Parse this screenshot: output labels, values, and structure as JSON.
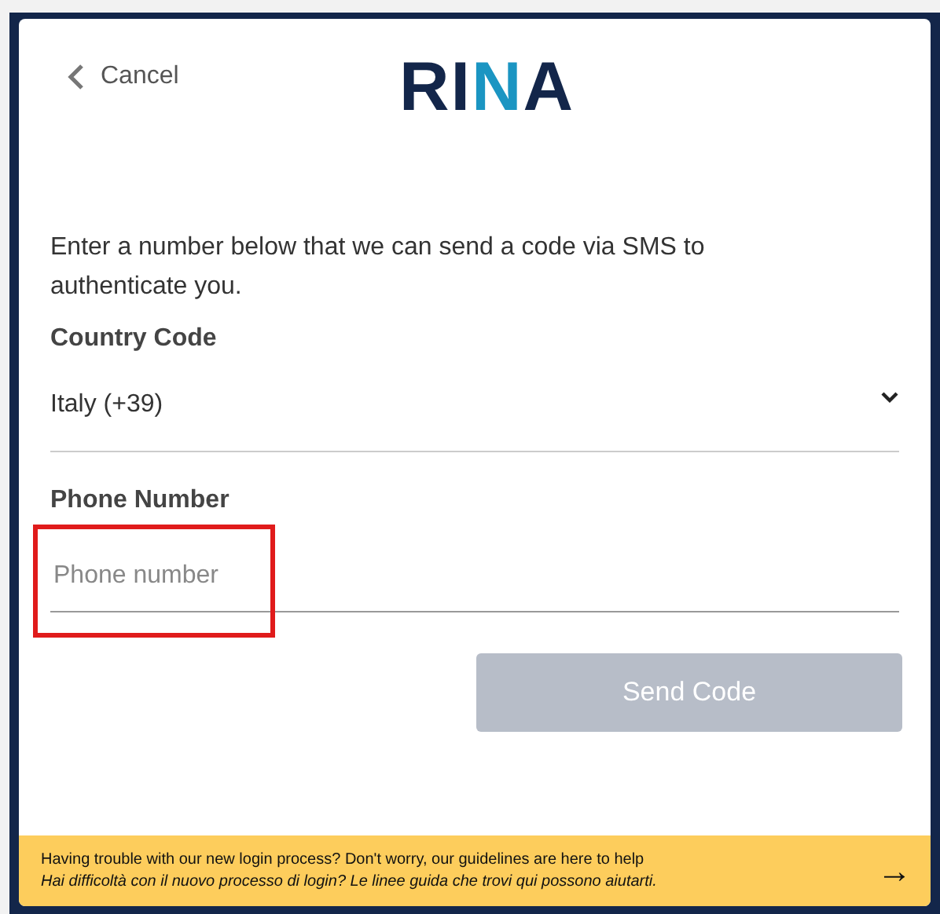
{
  "header": {
    "cancel": "Cancel",
    "logo": "RINA"
  },
  "intro": "Enter a number below that we can send a code via SMS to authenticate you.",
  "country": {
    "label": "Country Code",
    "value": "Italy (+39)"
  },
  "phone": {
    "label": "Phone Number",
    "placeholder": "Phone number",
    "highlighted": true
  },
  "send_button": {
    "label": "Send Code",
    "disabled": true
  },
  "banner": {
    "lines": [
      "Having trouble with our new login process? Don't worry, our guidelines are here to help",
      "Hai difficoltà con il nuovo processo di login? Le linee guida che trovi qui possono aiutarti."
    ],
    "arrow": "→"
  }
}
